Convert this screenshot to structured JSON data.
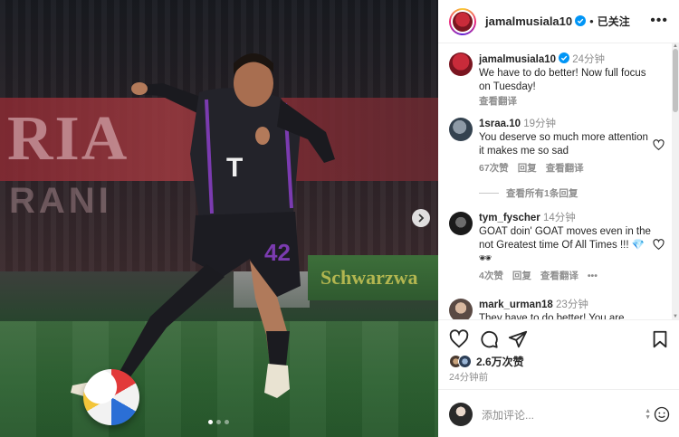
{
  "post": {
    "author": "jamalmusiala10",
    "follow_status": "已关注",
    "separator": "•",
    "more": "•••",
    "caption": {
      "user": "jamalmusiala10",
      "time": "24分钟",
      "text": "We have to do better! Now full focus on Tuesday!",
      "translate": "查看翻译"
    },
    "likes": "2.6万次赞",
    "posted": "24分钟前",
    "comment_placeholder": "添加评论...",
    "photo": {
      "banner_text": "RIA",
      "banner_text_2": "RANI",
      "board_text": "Schwarzwa",
      "shirt_sponsor": "T",
      "shirt_number": "42",
      "carousel_index": 1,
      "carousel_total": 3
    }
  },
  "comments": [
    {
      "user": "1sraa.10",
      "time": "19分钟",
      "text": "You deserve so much more attention it makes me so sad",
      "likes": "67次赞",
      "reply": "回复",
      "translate": "查看翻译",
      "view_replies": "查看所有1条回复"
    },
    {
      "user": "tym_fyscher",
      "time": "14分钟",
      "text": "GOAT doin' GOAT moves even in the not Greatest time Of All Times !!! 💎 🕶",
      "likes": "4次赞",
      "reply": "回复",
      "translate": "查看翻译",
      "more": "•••"
    },
    {
      "user": "mark_urman18",
      "time": "23分钟",
      "text": "They have to do better! You are"
    }
  ],
  "icons": {
    "verified": "verified-badge-icon",
    "like": "heart-icon",
    "comment": "comment-icon",
    "share": "send-icon",
    "save": "bookmark-icon",
    "next": "chevron-right-icon",
    "emoji": "emoji-icon"
  },
  "colors": {
    "verified_blue": "#0095f6",
    "muted_text": "#8e8e8e",
    "text": "#262626",
    "club_red": "#c92b3a"
  }
}
